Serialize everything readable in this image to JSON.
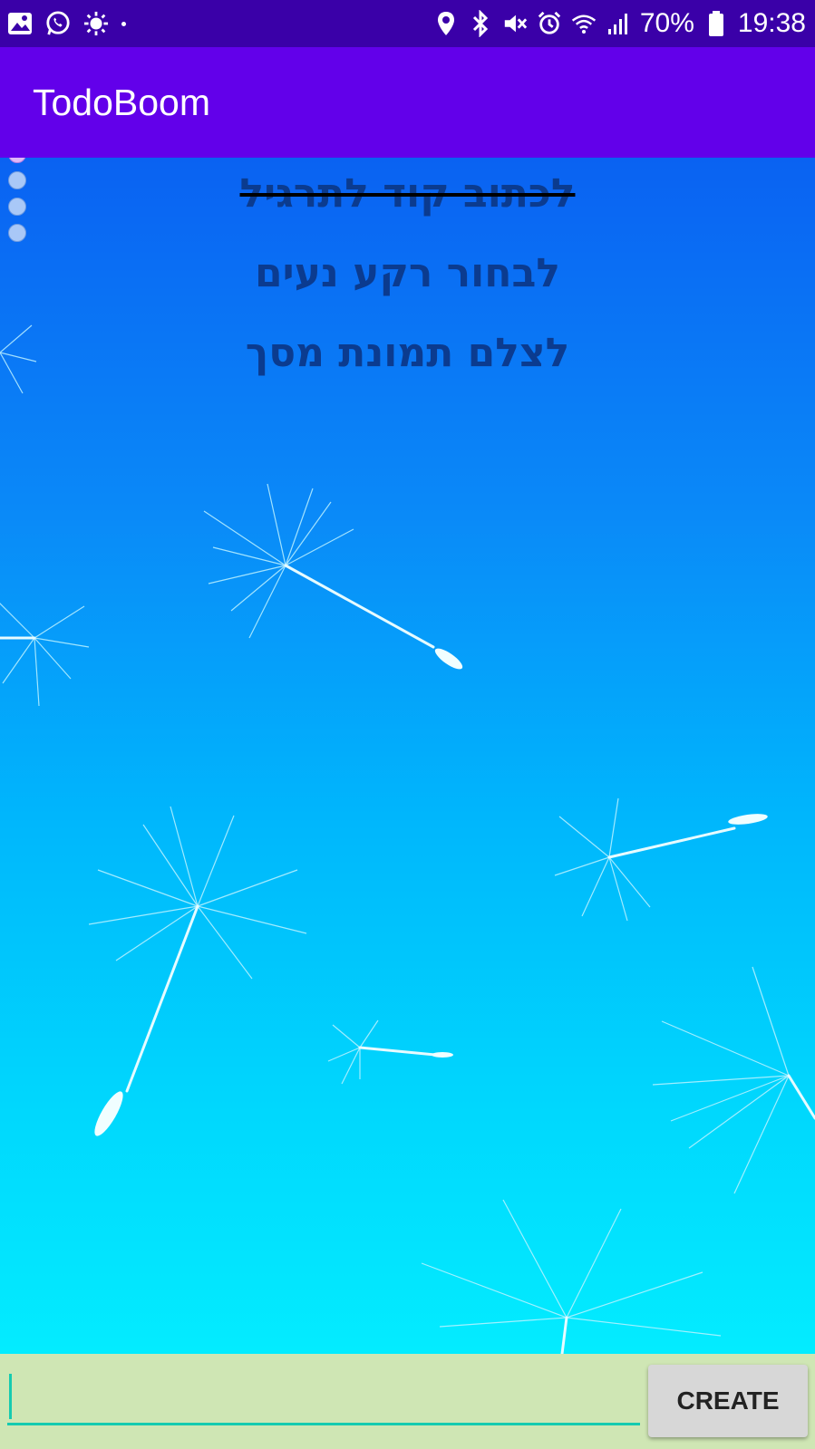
{
  "status_bar": {
    "icons_left": [
      "gallery-icon",
      "whatsapp-icon",
      "brightness-icon",
      "dot-icon"
    ],
    "icons_right": [
      "location-icon",
      "bluetooth-icon",
      "mute-icon",
      "alarm-icon",
      "wifi-icon",
      "signal-icon",
      "battery-icon"
    ],
    "battery_percent": "70%",
    "time": "19:38"
  },
  "app_bar": {
    "title": "TodoBoom"
  },
  "todos": [
    {
      "text": "לכתוב קוד לתרגיל",
      "done": true
    },
    {
      "text": "לבחור רקע נעים",
      "done": false
    },
    {
      "text": "לצלם תמונת מסך",
      "done": false
    }
  ],
  "input": {
    "value": "",
    "placeholder": ""
  },
  "create_button": {
    "label": "CREATE"
  },
  "colors": {
    "status_bar": "#3a00a8",
    "app_bar": "#6200ea",
    "bottom_bar": "#cfe6b4",
    "input_underline": "#15cbb0",
    "todo_text": "#0b3b8f"
  }
}
